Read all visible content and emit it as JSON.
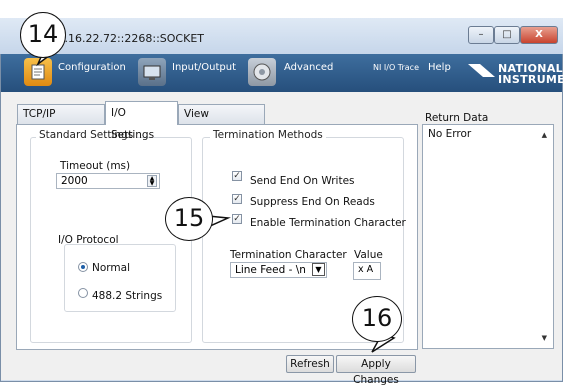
{
  "window": {
    "title": "...72.16.22.72::2268::SOCKET",
    "minimize": "–",
    "maximize": "□",
    "close": "X"
  },
  "toolbar": {
    "configuration": "Configuration",
    "input_output": "Input/Output",
    "advanced": "Advanced",
    "ni_io_trace": "NI I/O Trace",
    "help": "Help",
    "logo_line1": "NATIONAL",
    "logo_line2": "INSTRUMENTS"
  },
  "tabs": [
    "TCP/IP Settings",
    "I/O Settings",
    "View Attributes"
  ],
  "standard_settings": {
    "title": "Standard Settings",
    "timeout_label": "Timeout (ms)",
    "timeout_value": "2000",
    "io_protocol_label": "I/O Protocol",
    "radio_normal": "Normal",
    "radio_4882": "488.2 Strings"
  },
  "termination": {
    "title": "Termination Methods",
    "send_end": "Send End On Writes",
    "suppress_end": "Suppress End On Reads",
    "enable_term": "Enable Termination Character",
    "term_char_label": "Termination Character",
    "term_char_value": "Line Feed - \\n",
    "value_label": "Value",
    "value_value": "x A"
  },
  "return_data": {
    "label": "Return Data",
    "text": "No Error"
  },
  "buttons": {
    "refresh": "Refresh",
    "apply": "Apply Changes"
  },
  "callouts": [
    "14",
    "15",
    "16"
  ],
  "colors": {
    "toolbar": "#2f5f8f",
    "tab_active": "#ffffff"
  }
}
